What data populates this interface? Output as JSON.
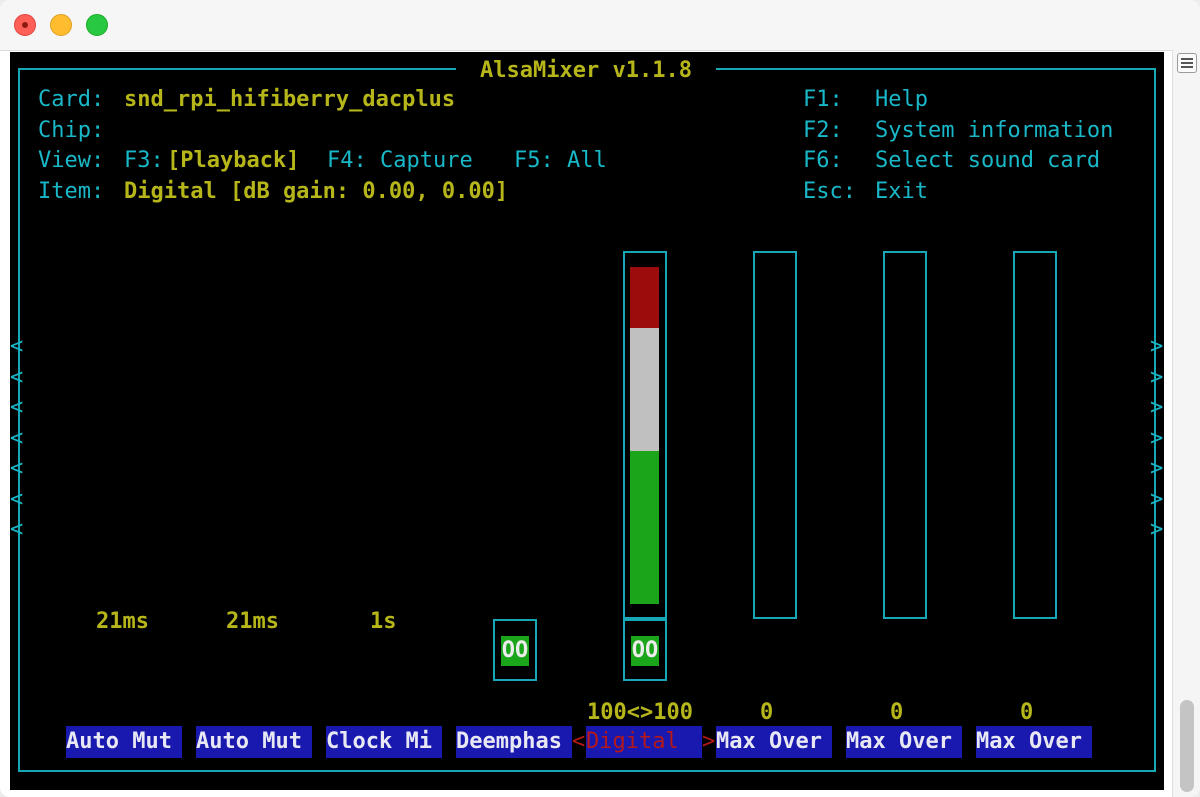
{
  "window": {
    "title": ""
  },
  "mixer": {
    "title": "AlsaMixer v1.1.8",
    "card_label": "Card:",
    "card_value": "snd_rpi_hifiberry_dacplus",
    "chip_label": "Chip:",
    "view_label": "View:",
    "view_f3": "F3:",
    "view_playback": "[Playback]",
    "view_f4": "F4: Capture",
    "view_f5": "F5: All",
    "item_label": "Item:",
    "item_value": "Digital [dB gain: 0.00, 0.00]",
    "help": [
      {
        "key": "F1:",
        "label": "Help"
      },
      {
        "key": "F2:",
        "label": "System information"
      },
      {
        "key": "F6:",
        "label": "Select sound card"
      },
      {
        "key": "Esc:",
        "label": "Exit"
      }
    ],
    "left_scroll_glyph": "<",
    "right_scroll_glyph": ">",
    "scroll_glyph_count": 7,
    "controls": [
      {
        "name": "Auto Mut",
        "value_text": "21ms",
        "selected": false
      },
      {
        "name": "Auto Mut",
        "value_text": "21ms",
        "selected": false
      },
      {
        "name": "Clock Mi",
        "value_text": "1s",
        "selected": false
      },
      {
        "name": "Deemphas",
        "switch": "OO",
        "selected": false
      },
      {
        "name": "Digital ",
        "left_arrow": "<",
        "right_arrow": ">",
        "volume_text": "100<>100",
        "switch": "OO",
        "level_percent": 100,
        "selected": true
      },
      {
        "name": "Max Over",
        "volume_text": "0",
        "level_percent": 0,
        "selected": false
      },
      {
        "name": "Max Over",
        "volume_text": "0",
        "level_percent": 0,
        "selected": false
      },
      {
        "name": "Max Over",
        "volume_text": "0",
        "level_percent": 0,
        "selected": false
      }
    ],
    "colors": {
      "frame": "#17a8b8",
      "label_cyan": "#19b8c8",
      "value_yellow": "#b6b61a",
      "bar_red": "#9c0c0c",
      "bar_white": "#c0c0c0",
      "bar_green": "#1aa51a",
      "name_bg": "#1919b0"
    }
  }
}
